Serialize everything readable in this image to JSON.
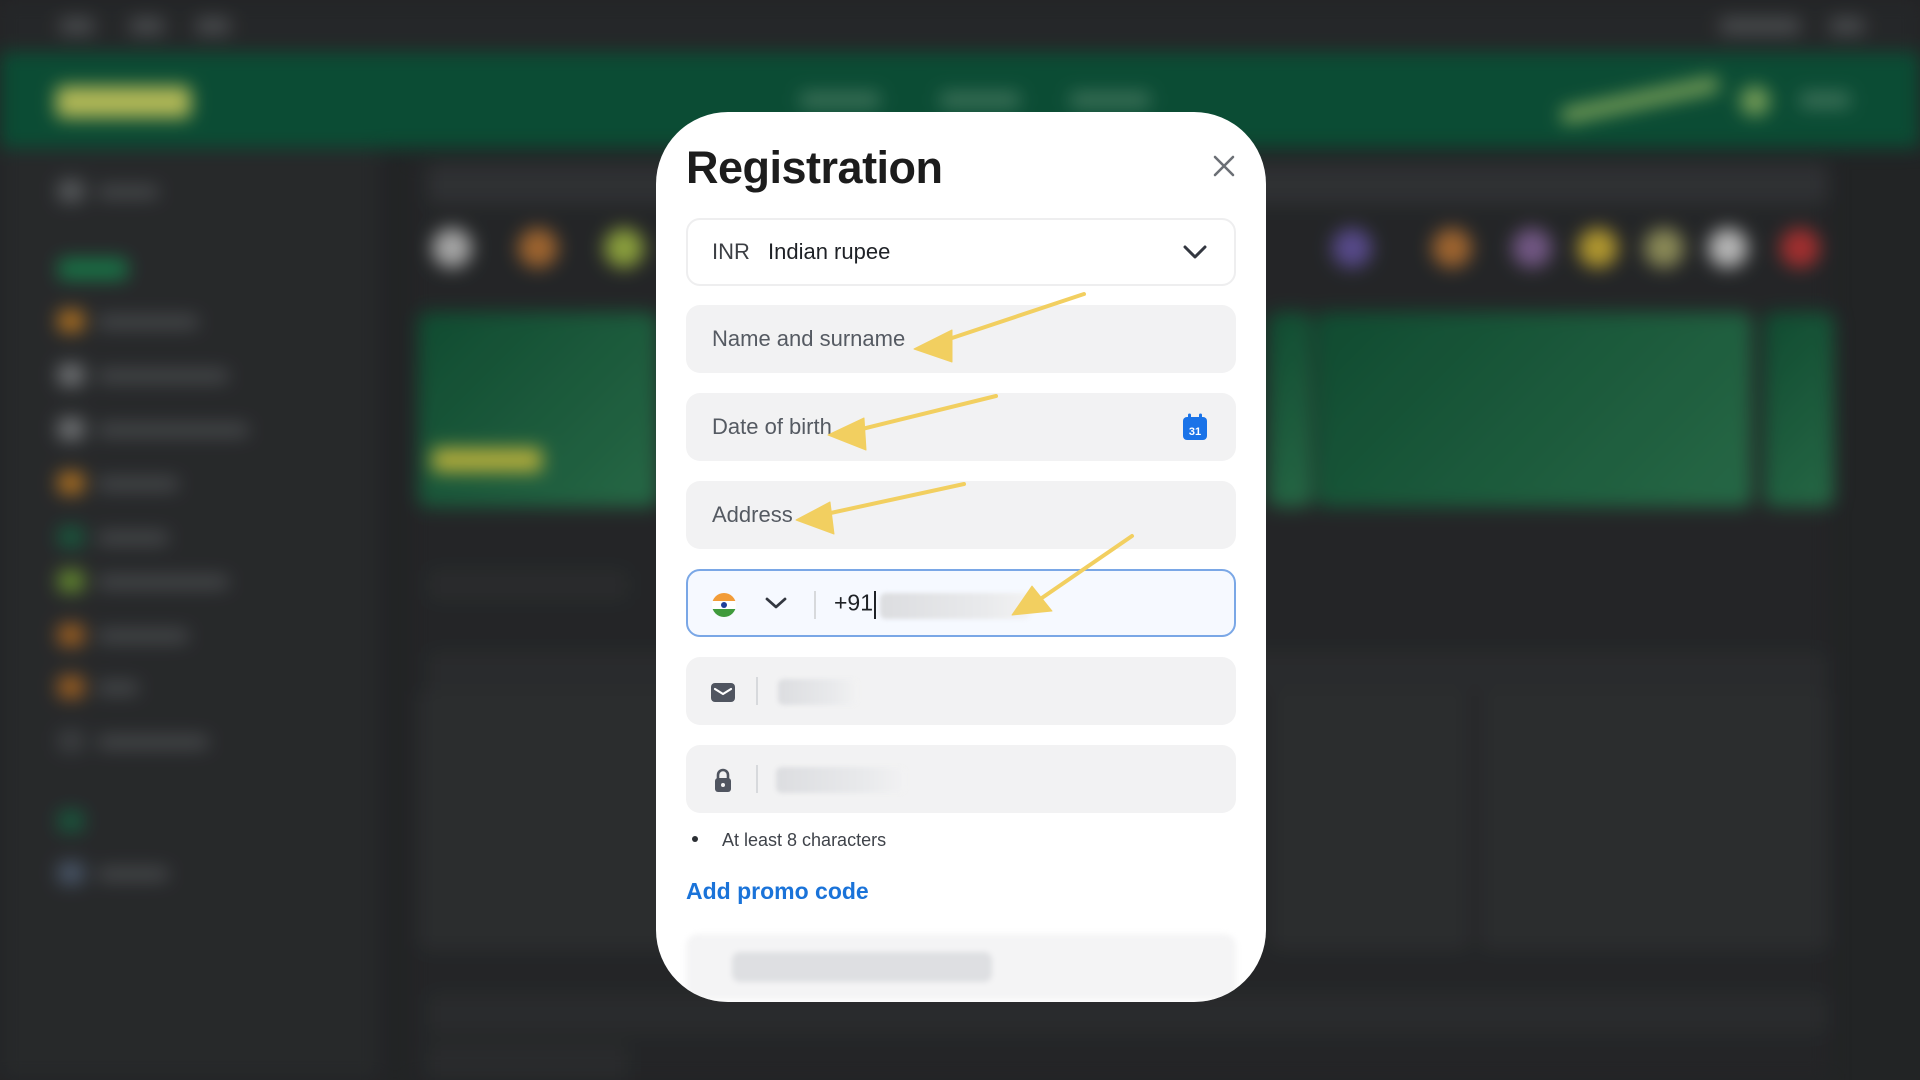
{
  "modal": {
    "title": "Registration",
    "currency": {
      "code": "INR",
      "name": "Indian rupee"
    },
    "fields": {
      "name_placeholder": "Name and surname",
      "dob_placeholder": "Date of birth",
      "address_placeholder": "Address"
    },
    "phone": {
      "dial_code": "+91"
    },
    "password_hint": "At least 8 characters",
    "promo_link": "Add promo code",
    "calendar_day": "31"
  },
  "icons": {
    "close": "close-icon",
    "chevron": "chevron-down-icon",
    "calendar": "calendar-icon",
    "flag": "india-flag-icon",
    "email": "envelope-icon",
    "password": "lock-icon"
  },
  "colors": {
    "accent": "#1a73d9",
    "arrow": "#f2cf60",
    "header_bg": "#0e5d40"
  }
}
